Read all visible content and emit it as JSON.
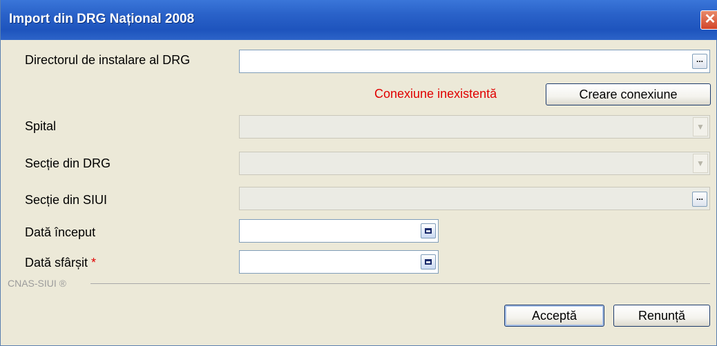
{
  "window": {
    "title": "Import din DRG Național 2008",
    "close_symbol": "✕"
  },
  "fields": {
    "install_dir": {
      "label": "Directorul de instalare al DRG",
      "value": "",
      "button": "..."
    },
    "connection_status": "Conexiune inexistentă",
    "create_connection_button": "Creare conexiune",
    "spital": {
      "label": "Spital",
      "value": ""
    },
    "sectie_drg": {
      "label": "Secție din DRG",
      "value": ""
    },
    "sectie_siui": {
      "label": "Secție din SIUI",
      "value": "",
      "button": "..."
    },
    "data_inceput": {
      "label": "Dată început",
      "value": ""
    },
    "data_sfarsit": {
      "label": "Dată sfârșit",
      "required_marker": "*",
      "value": ""
    }
  },
  "footer": {
    "brand": "CNAS-SIUI ®"
  },
  "buttons": {
    "accept": "Acceptă",
    "cancel": "Renunță"
  },
  "colors": {
    "titlebar": "#2a62c9",
    "error_text": "#e00000",
    "background": "#ece9d8"
  }
}
